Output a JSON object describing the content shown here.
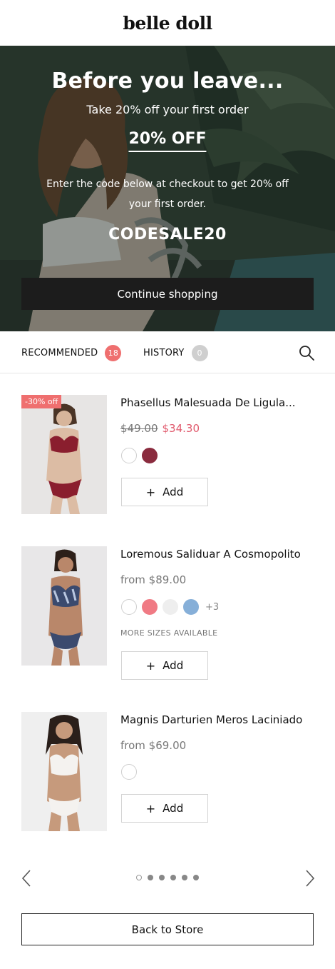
{
  "header": {
    "logo": "belle doll"
  },
  "hero": {
    "title": "Before you leave...",
    "subtitle": "Take 20% off your first order",
    "offer": "20% OFF",
    "description": "Enter the code below at checkout to get 20% off your first order.",
    "code": "CODESALE20",
    "button_label": "Continue shopping"
  },
  "tabs": {
    "recommended": {
      "label": "RECOMMENDED",
      "count": "18"
    },
    "history": {
      "label": "HISTORY",
      "count": "0"
    },
    "search_icon": "search-icon"
  },
  "products": [
    {
      "discount": "-30% off",
      "name": "Phasellus Malesuada De Ligula...",
      "old_price": "$49.00",
      "new_price": "$34.30",
      "swatches": [
        "#ffffff",
        "#8a2b3e"
      ],
      "add_label": "Add"
    },
    {
      "name": "Loremous Saliduar A Cosmopolito",
      "price": "from $89.00",
      "swatches": [
        "#ffffff",
        "#f07a84",
        "#eeeeee",
        "#86afd8"
      ],
      "more_count": "+3",
      "more_sizes": "MORE SIZES AVAILABLE",
      "add_label": "Add"
    },
    {
      "name": "Magnis Darturien Meros Laciniado",
      "price": "from $69.00",
      "swatches": [
        "#ffffff"
      ],
      "add_label": "Add"
    }
  ],
  "pager": {
    "pages": 6,
    "active": 1,
    "prev_icon": "chevron-left-icon",
    "next_icon": "chevron-right-icon"
  },
  "footer": {
    "back_label": "Back to Store"
  },
  "colors": {
    "accent": "#ef6f6f",
    "price_sale": "#e05a6d",
    "dark_button": "#1c1c1c"
  }
}
